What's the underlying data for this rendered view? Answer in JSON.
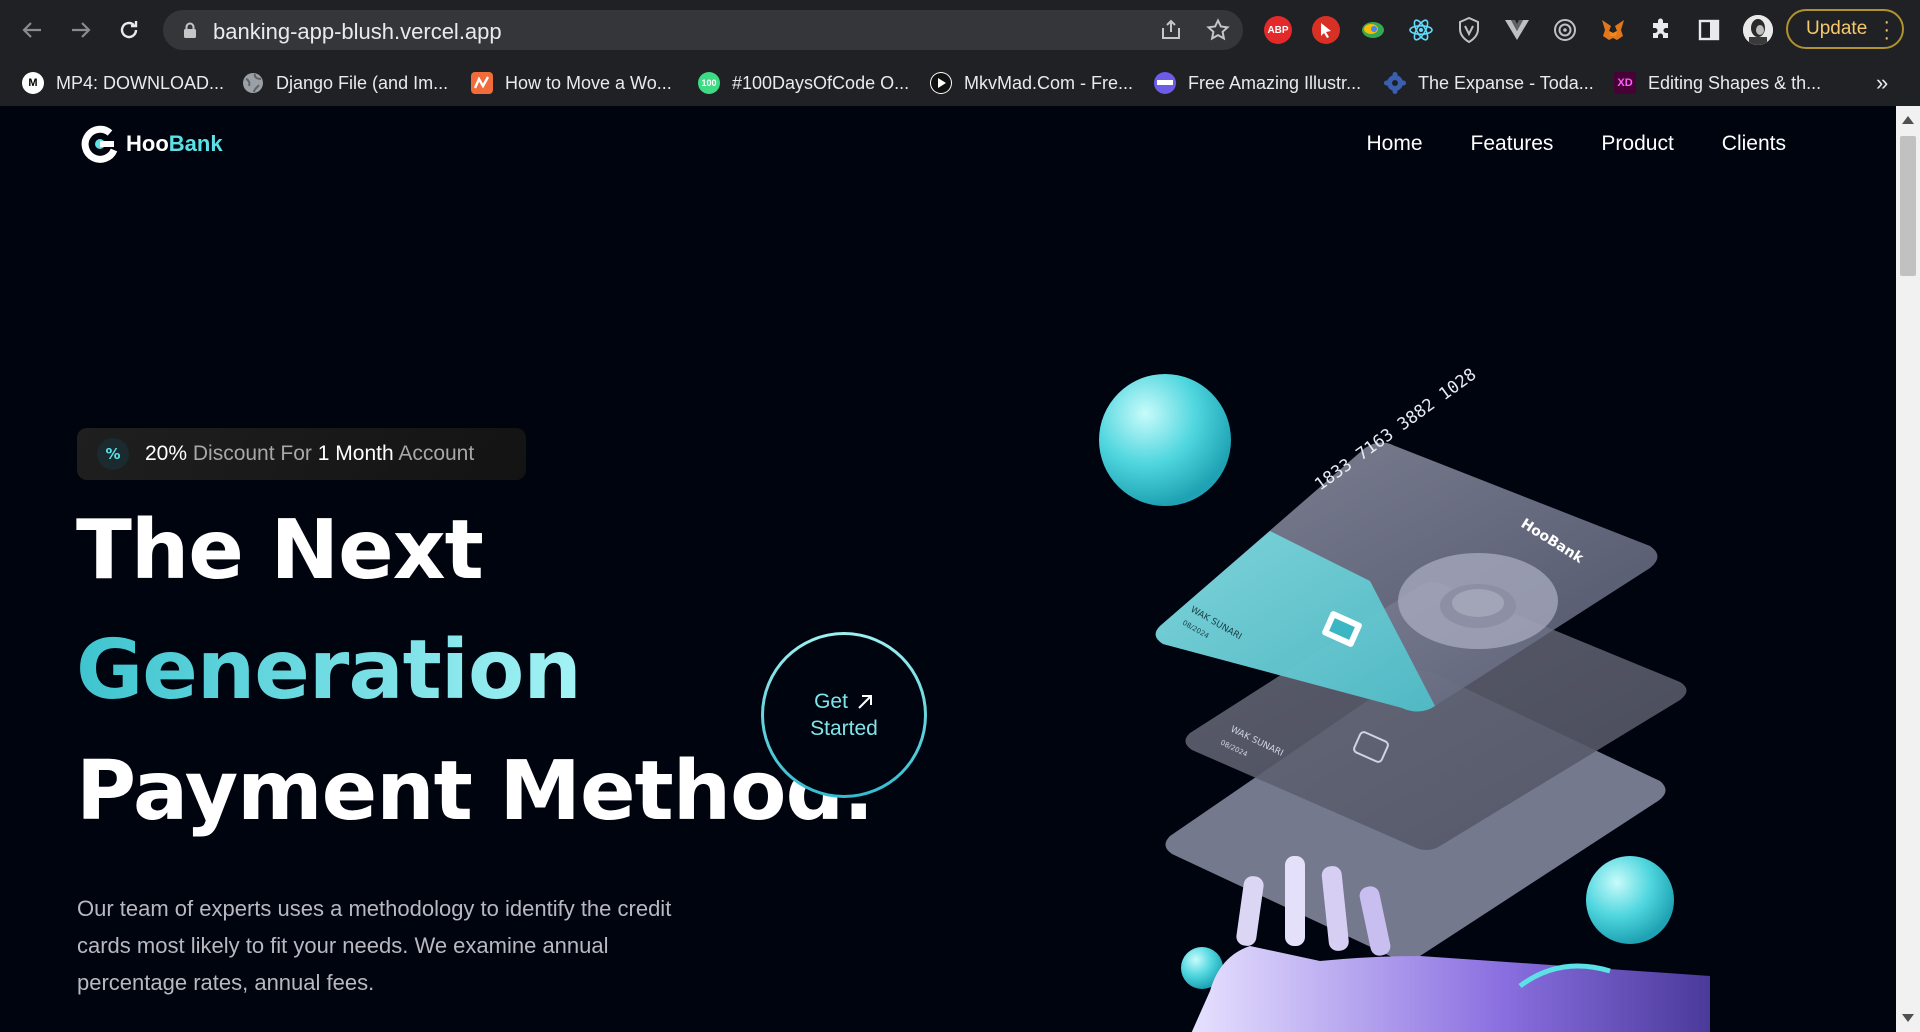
{
  "browser": {
    "url": "banking-app-blush.vercel.app",
    "update_label": "Update",
    "extensions": [
      "adblock-plus-icon",
      "cursor-extension-icon",
      "colorful-extension-icon",
      "react-devtools-icon",
      "vpn-shield-icon",
      "vue-devtools-icon",
      "target-extension-icon",
      "metamask-icon",
      "extensions-puzzle-icon",
      "side-panel-icon",
      "profile-avatar"
    ],
    "abp_label": "ABP",
    "bookmarks": [
      {
        "label": "MP4: DOWNLOAD...",
        "icon": "M",
        "color": "#000000"
      },
      {
        "label": "Django File (and Im...",
        "icon": "",
        "color": "#5f6368"
      },
      {
        "label": "How to Move a Wo...",
        "icon": "",
        "color": "#f26b3a"
      },
      {
        "label": "#100DaysOfCode O...",
        "icon": "100",
        "color": "#3ddc84"
      },
      {
        "label": "MkvMad.Com - Fre...",
        "icon": "",
        "color": "#ffffff"
      },
      {
        "label": "Free Amazing Illustr...",
        "icon": "",
        "color": "#6c5ce7"
      },
      {
        "label": "The Expanse - Toda...",
        "icon": "",
        "color": "#3a5fb0"
      },
      {
        "label": "Editing Shapes & th...",
        "icon": "XD",
        "color": "#470137"
      }
    ]
  },
  "site": {
    "logo_hoo": "Hoo",
    "logo_bank": "Bank",
    "nav": [
      "Home",
      "Features",
      "Product",
      "Clients"
    ],
    "badge": {
      "p1": "20%",
      "p2": " Discount For ",
      "p3": "1",
      "p4": " Month",
      "p5": " Account"
    },
    "title_line1": "The Next",
    "title_line2": "Generation",
    "title_line3": "Payment Method.",
    "description": "Our team of experts uses a methodology to identify the credit cards most likely to fit your needs. We examine annual percentage rates, annual fees.",
    "cta_line1": "Get",
    "cta_line2": "Started",
    "card_number": "1833 7163 3882 1028",
    "card_holder": "WAK SUNARI",
    "card_expiry": "08/2024",
    "card_brand": "HooBank",
    "accent_color": "#5ce1e6",
    "background_color": "#00040f"
  }
}
